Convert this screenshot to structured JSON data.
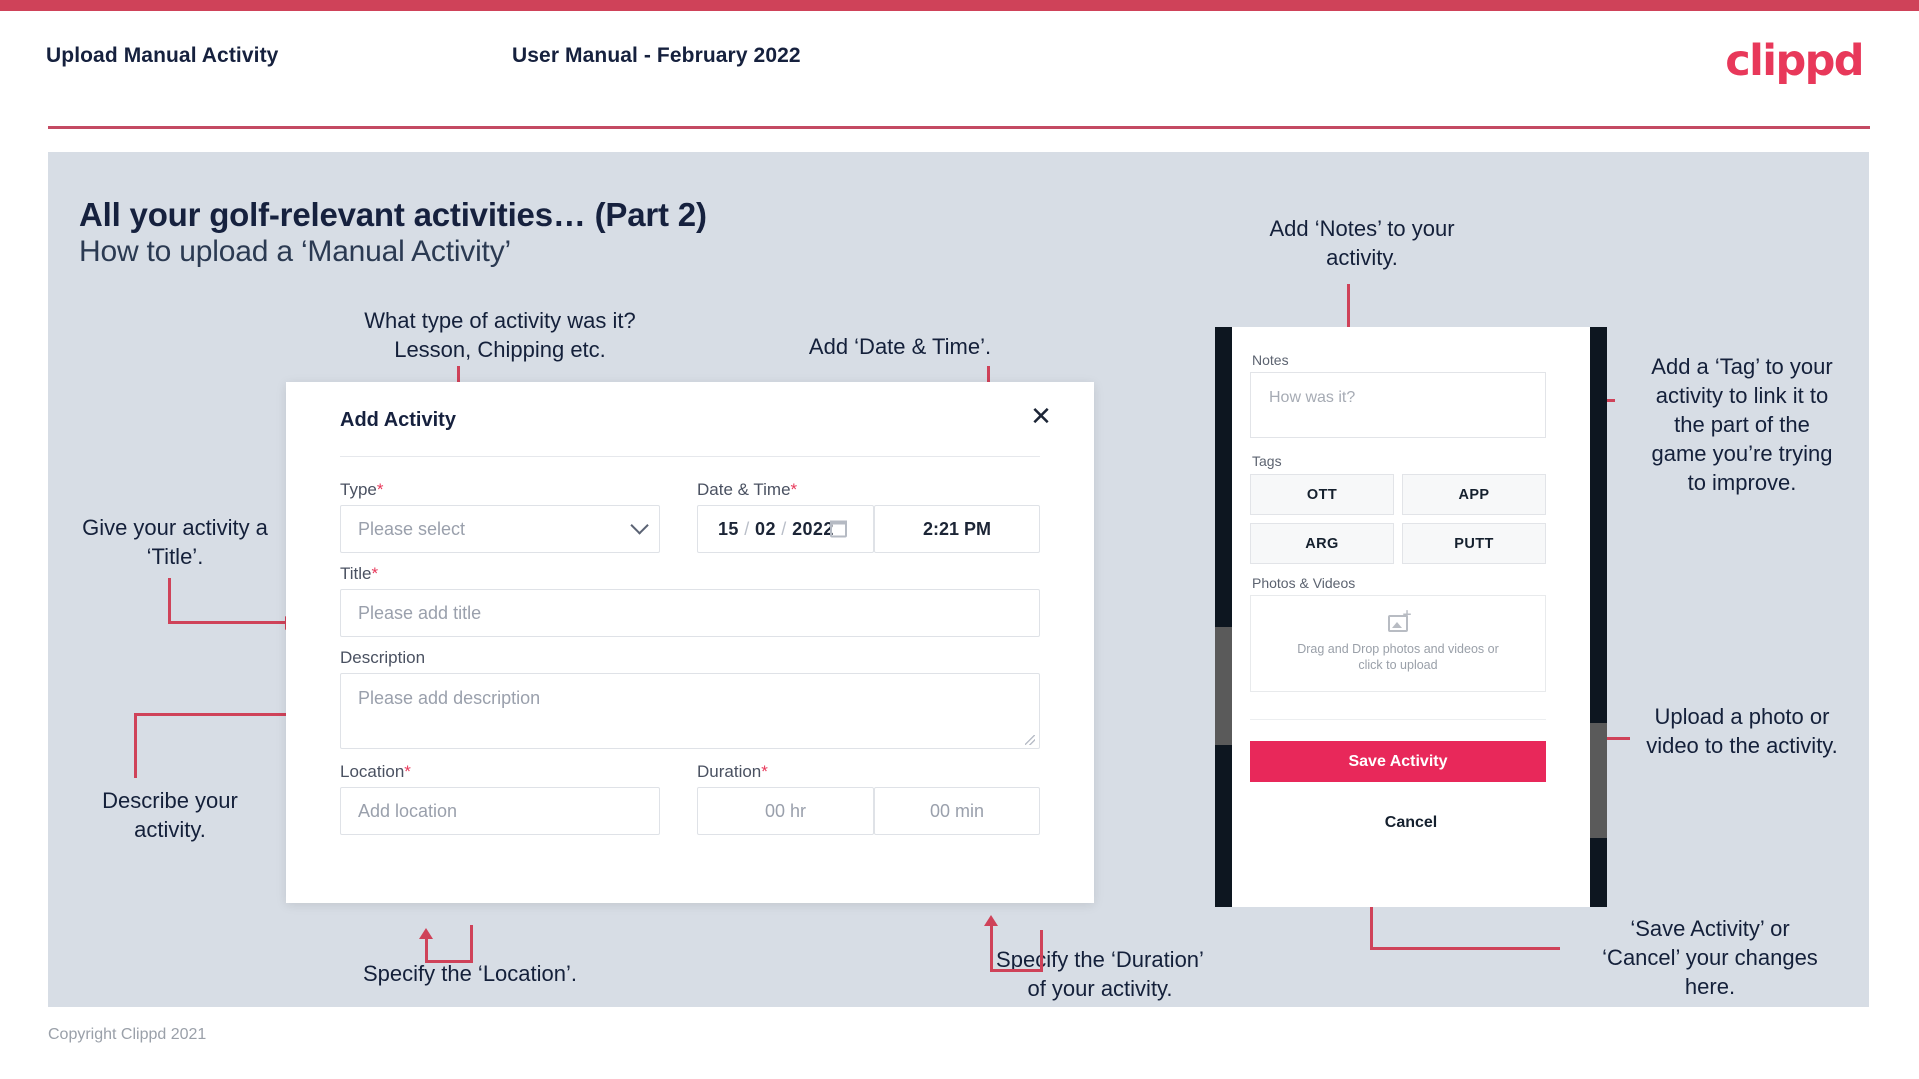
{
  "header": {
    "left_title": "Upload Manual Activity",
    "center_title": "User Manual - February 2022",
    "logo": "clippd"
  },
  "slide": {
    "title": "All your golf-relevant activities… (Part 2)",
    "subtitle": "How to upload a ‘Manual Activity’"
  },
  "annotations": {
    "type": "What type of activity was it?\nLesson, Chipping etc.",
    "datetime": "Add ‘Date & Time’.",
    "notes": "Add ‘Notes’ to your\nactivity.",
    "tag": "Add a ‘Tag’ to your\nactivity to link it to\nthe part of the\ngame you’re trying\nto improve.",
    "title_field": "Give your activity a\n‘Title’.",
    "description": "Describe your\nactivity.",
    "location": "Specify the ‘Location’.",
    "duration": "Specify the ‘Duration’\nof your activity.",
    "upload": "Upload a photo or\nvideo to the activity.",
    "save_cancel": "‘Save Activity’ or\n‘Cancel’ your changes\nhere."
  },
  "modal": {
    "title": "Add Activity",
    "close_icon": "close-icon",
    "type": {
      "label": "Type",
      "required": "*",
      "placeholder": "Please select"
    },
    "datetime": {
      "label": "Date & Time",
      "required": "*",
      "day": "15",
      "month": "02",
      "year": "2022",
      "sep": "/",
      "time": "2:21 PM",
      "calendar_icon": "calendar-icon"
    },
    "title_field": {
      "label": "Title",
      "required": "*",
      "placeholder": "Please add title"
    },
    "description": {
      "label": "Description",
      "placeholder": "Please add description"
    },
    "location": {
      "label": "Location",
      "required": "*",
      "placeholder": "Add location"
    },
    "duration": {
      "label": "Duration",
      "required": "*",
      "hours_placeholder": "00 hr",
      "minutes_placeholder": "00 min"
    }
  },
  "phone": {
    "notes": {
      "label": "Notes",
      "placeholder": "How was it?"
    },
    "tags": {
      "label": "Tags",
      "items": [
        "OTT",
        "APP",
        "ARG",
        "PUTT"
      ]
    },
    "photos": {
      "label": "Photos & Videos",
      "upload_icon": "image-add-icon",
      "hint_line1": "Drag and Drop photos and videos or",
      "hint_line2": "click to upload"
    },
    "save_label": "Save Activity",
    "cancel_label": "Cancel"
  },
  "footer": {
    "copyright": "Copyright Clippd 2021"
  },
  "colors": {
    "accent": "#e8385a",
    "bar": "#cf4259",
    "card": "#d7dde5",
    "ink": "#16213e"
  }
}
